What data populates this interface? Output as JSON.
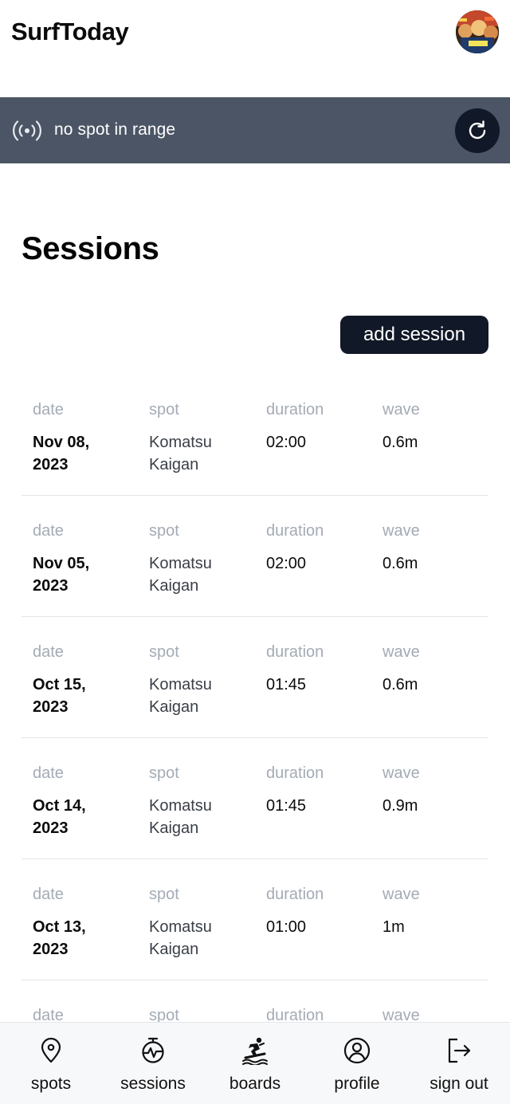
{
  "header": {
    "app_title": "SurfToday"
  },
  "banner": {
    "status_text": "no spot in range"
  },
  "main": {
    "title": "Sessions",
    "add_button_label": "add session"
  },
  "columns": {
    "date": "date",
    "spot": "spot",
    "duration": "duration",
    "wave": "wave"
  },
  "sessions": [
    {
      "date_line1": "Nov 08,",
      "date_line2": "2023",
      "spot_line1": "Komatsu",
      "spot_line2": "Kaigan",
      "duration": "02:00",
      "wave": "0.6m"
    },
    {
      "date_line1": "Nov 05,",
      "date_line2": "2023",
      "spot_line1": "Komatsu",
      "spot_line2": "Kaigan",
      "duration": "02:00",
      "wave": "0.6m"
    },
    {
      "date_line1": "Oct 15,",
      "date_line2": "2023",
      "spot_line1": "Komatsu",
      "spot_line2": "Kaigan",
      "duration": "01:45",
      "wave": "0.6m"
    },
    {
      "date_line1": "Oct 14,",
      "date_line2": "2023",
      "spot_line1": "Komatsu",
      "spot_line2": "Kaigan",
      "duration": "01:45",
      "wave": "0.9m"
    },
    {
      "date_line1": "Oct 13,",
      "date_line2": "2023",
      "spot_line1": "Komatsu",
      "spot_line2": "Kaigan",
      "duration": "01:00",
      "wave": "1m"
    },
    {
      "date_line1": "",
      "date_line2": "",
      "spot_line1": "",
      "spot_line2": "",
      "duration": "",
      "wave": ""
    }
  ],
  "nav": {
    "items": [
      {
        "label": "spots",
        "icon": "map-pin-icon"
      },
      {
        "label": "sessions",
        "icon": "stopwatch-activity-icon"
      },
      {
        "label": "boards",
        "icon": "surfer-icon"
      },
      {
        "label": "profile",
        "icon": "user-circle-icon"
      },
      {
        "label": "sign out",
        "icon": "sign-out-icon"
      }
    ]
  },
  "colors": {
    "banner_bg": "#4b5565",
    "dark_button": "#111827",
    "label_gray": "#a4abb5",
    "nav_bg": "#f7f8fa"
  }
}
